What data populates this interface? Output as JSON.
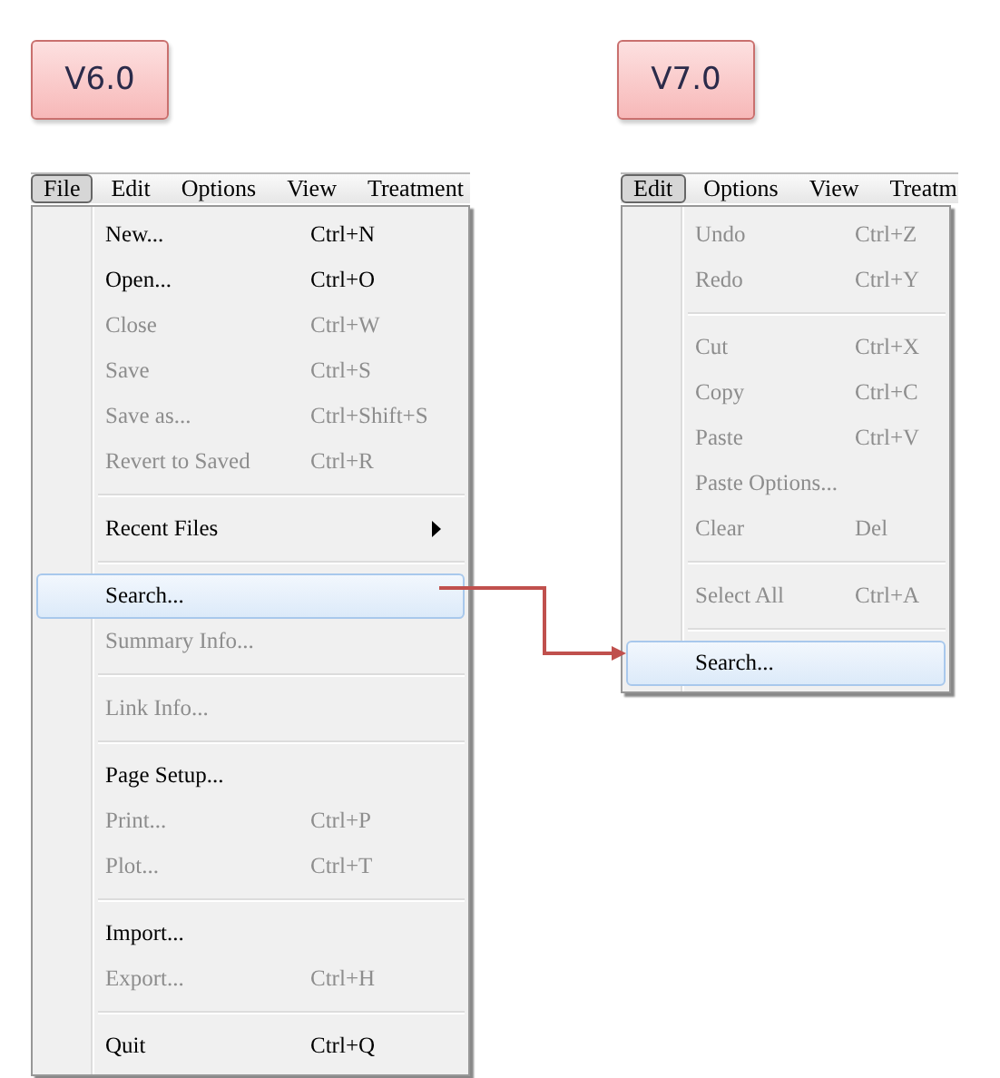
{
  "panels": [
    {
      "version": "V6.0",
      "menubar": [
        {
          "label": "File",
          "selected": true
        },
        {
          "label": "Edit",
          "selected": false
        },
        {
          "label": "Options",
          "selected": false
        },
        {
          "label": "View",
          "selected": false
        },
        {
          "label": "Treatment",
          "selected": false
        }
      ],
      "items": [
        {
          "kind": "item",
          "label": "New...",
          "shortcut": "Ctrl+N",
          "disabled": false,
          "selected": false
        },
        {
          "kind": "item",
          "label": "Open...",
          "shortcut": "Ctrl+O",
          "disabled": false,
          "selected": false
        },
        {
          "kind": "item",
          "label": "Close",
          "shortcut": "Ctrl+W",
          "disabled": true,
          "selected": false
        },
        {
          "kind": "item",
          "label": "Save",
          "shortcut": "Ctrl+S",
          "disabled": true,
          "selected": false
        },
        {
          "kind": "item",
          "label": "Save as...",
          "shortcut": "Ctrl+Shift+S",
          "disabled": true,
          "selected": false
        },
        {
          "kind": "item",
          "label": "Revert to Saved",
          "shortcut": "Ctrl+R",
          "disabled": true,
          "selected": false
        },
        {
          "kind": "separator"
        },
        {
          "kind": "submenu",
          "label": "Recent Files",
          "disabled": false,
          "selected": false
        },
        {
          "kind": "separator"
        },
        {
          "kind": "item",
          "label": "Search...",
          "disabled": false,
          "selected": true
        },
        {
          "kind": "item",
          "label": "Summary Info...",
          "disabled": true,
          "selected": false
        },
        {
          "kind": "separator"
        },
        {
          "kind": "item",
          "label": "Link Info...",
          "disabled": true,
          "selected": false
        },
        {
          "kind": "separator"
        },
        {
          "kind": "item",
          "label": "Page Setup...",
          "disabled": false,
          "selected": false
        },
        {
          "kind": "item",
          "label": "Print...",
          "shortcut": "Ctrl+P",
          "disabled": true,
          "selected": false
        },
        {
          "kind": "item",
          "label": "Plot...",
          "shortcut": "Ctrl+T",
          "disabled": true,
          "selected": false
        },
        {
          "kind": "separator"
        },
        {
          "kind": "item",
          "label": "Import...",
          "disabled": false,
          "selected": false
        },
        {
          "kind": "item",
          "label": "Export...",
          "shortcut": "Ctrl+H",
          "disabled": true,
          "selected": false
        },
        {
          "kind": "separator"
        },
        {
          "kind": "item",
          "label": "Quit",
          "shortcut": "Ctrl+Q",
          "disabled": false,
          "selected": false
        }
      ]
    },
    {
      "version": "V7.0",
      "menubar": [
        {
          "label": "Edit",
          "selected": true
        },
        {
          "label": "Options",
          "selected": false
        },
        {
          "label": "View",
          "selected": false
        },
        {
          "label": "Treatm",
          "selected": false
        }
      ],
      "items": [
        {
          "kind": "item",
          "label": "Undo",
          "shortcut": "Ctrl+Z",
          "disabled": true,
          "selected": false
        },
        {
          "kind": "item",
          "label": "Redo",
          "shortcut": "Ctrl+Y",
          "disabled": true,
          "selected": false
        },
        {
          "kind": "separator"
        },
        {
          "kind": "item",
          "label": "Cut",
          "shortcut": "Ctrl+X",
          "disabled": true,
          "selected": false
        },
        {
          "kind": "item",
          "label": "Copy",
          "shortcut": "Ctrl+C",
          "disabled": true,
          "selected": false
        },
        {
          "kind": "item",
          "label": "Paste",
          "shortcut": "Ctrl+V",
          "disabled": true,
          "selected": false
        },
        {
          "kind": "item",
          "label": "Paste Options...",
          "disabled": true,
          "selected": false
        },
        {
          "kind": "item",
          "label": "Clear",
          "shortcut": "Del",
          "disabled": true,
          "selected": false
        },
        {
          "kind": "separator"
        },
        {
          "kind": "item",
          "label": "Select All",
          "shortcut": "Ctrl+A",
          "disabled": true,
          "selected": false
        },
        {
          "kind": "separator"
        },
        {
          "kind": "item",
          "label": "Search...",
          "disabled": false,
          "selected": true
        }
      ]
    }
  ]
}
